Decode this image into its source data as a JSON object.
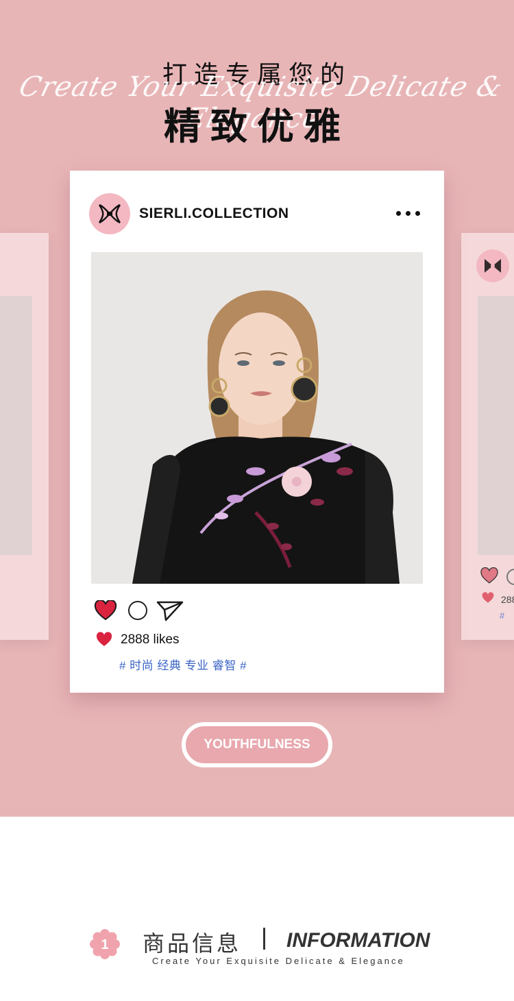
{
  "header": {
    "line1": "打造专属您的",
    "script_text": "Create Your Exquisite Delicate & Elegance",
    "line2": "精致优雅"
  },
  "post": {
    "username": "SIERLI.COLLECTION",
    "more_icon": "more-horizontal-icon",
    "likes_text": "2888 likes",
    "hashtags": "# 时尚 经典 专业 睿智 #"
  },
  "side_card_right": {
    "likes_text": "288",
    "tag_text": "#"
  },
  "badge": {
    "label": "YOUTHFULNESS"
  },
  "info_section": {
    "number": "1",
    "title_cn": "商品信息",
    "title_en": "INFORMATION",
    "subtitle": "Create Your Exquisite Delicate & Elegance"
  },
  "colors": {
    "hero_bg": "#e8b5b7",
    "card_bg": "#ffffff",
    "heart_red": "#d9233f",
    "hashtag_blue": "#3a63c6",
    "avatar_pink": "#f3b8c2"
  }
}
